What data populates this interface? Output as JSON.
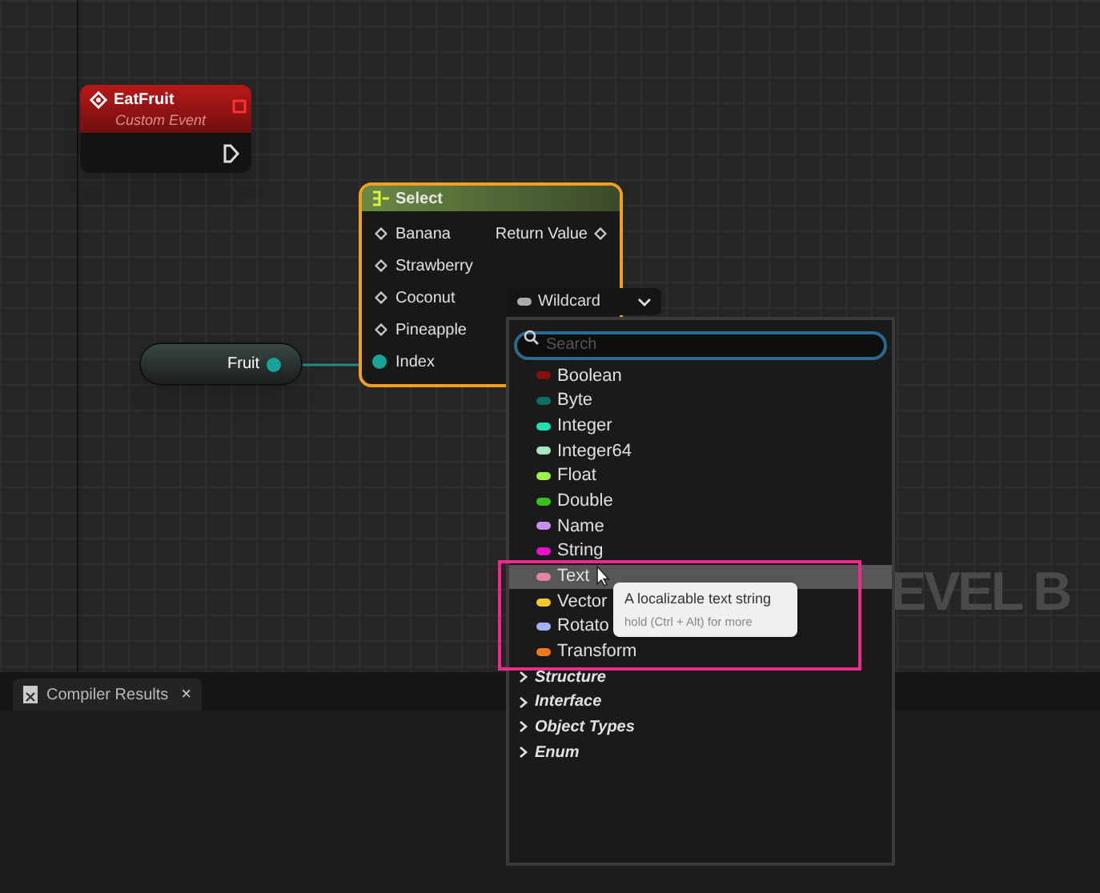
{
  "graph": {
    "watermark": "EVEL B",
    "event_node": {
      "title": "EatFruit",
      "subtitle": "Custom Event"
    },
    "select_node": {
      "title": "Select",
      "inputs": [
        "Banana",
        "Strawberry",
        "Coconut",
        "Pineapple"
      ],
      "output": "Return Value",
      "index_pin": "Index"
    },
    "variable_node": {
      "label": "Fruit"
    }
  },
  "type_picker": {
    "current": "Wildcard",
    "search": {
      "placeholder": "Search"
    },
    "types": [
      {
        "label": "Boolean",
        "color": "#8a0e0e",
        "selected": false
      },
      {
        "label": "Byte",
        "color": "#0d6e62",
        "selected": false
      },
      {
        "label": "Integer",
        "color": "#1fe0b0",
        "selected": false
      },
      {
        "label": "Integer64",
        "color": "#a8e6bc",
        "selected": false
      },
      {
        "label": "Float",
        "color": "#9ef24a",
        "selected": false
      },
      {
        "label": "Double",
        "color": "#38c21a",
        "selected": false
      },
      {
        "label": "Name",
        "color": "#c88ef0",
        "selected": false
      },
      {
        "label": "String",
        "color": "#ee10c8",
        "selected": false
      },
      {
        "label": "Text",
        "color": "#e483a8",
        "selected": true
      },
      {
        "label": "Vector",
        "color": "#f5c832",
        "selected": false
      },
      {
        "label": "Rotato",
        "color": "#a0b4f5",
        "selected": false
      },
      {
        "label": "Transform",
        "color": "#f07a1a",
        "selected": false
      }
    ],
    "categories": [
      {
        "label": "Structure",
        "expanded": false
      },
      {
        "label": "Interface",
        "expanded": false
      },
      {
        "label": "Object Types",
        "expanded": false
      },
      {
        "label": "Enum",
        "expanded": false
      }
    ],
    "tooltip": {
      "title": "A localizable text string",
      "hint": "hold (Ctrl + Alt) for more"
    }
  },
  "bottom_panel": {
    "tab": {
      "label": "Compiler Results",
      "close": "×"
    }
  }
}
